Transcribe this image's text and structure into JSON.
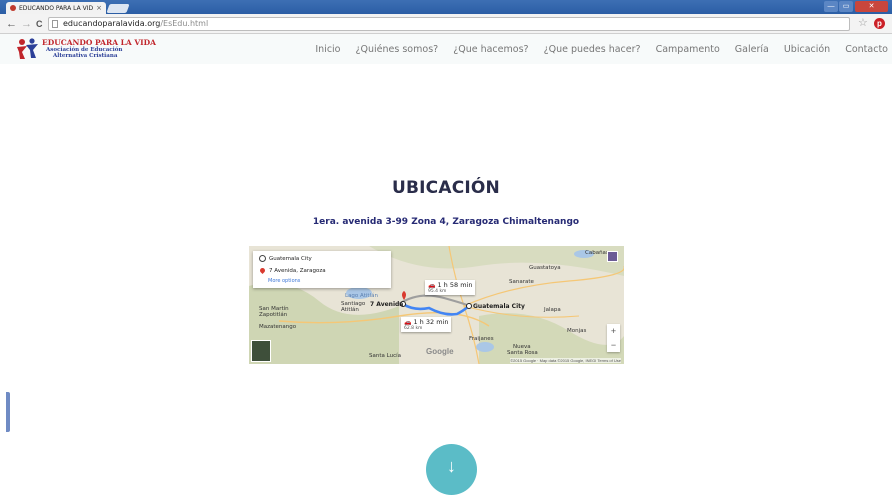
{
  "browser": {
    "tab_title": "EDUCANDO PARA LA VID",
    "tab_close": "×",
    "url_domain": "educandoparalavida.org",
    "url_path": "/EsEdu.html",
    "back": "←",
    "forward": "→",
    "reload": "C",
    "star": "☆",
    "pinterest": "p",
    "win_min": "—",
    "win_max": "▭",
    "win_close": "✕"
  },
  "site": {
    "brand_main": "EDUCANDO PARA LA VIDA",
    "brand_sub1": "Asociación de Educación",
    "brand_sub2": "Alternativa Cristiana",
    "brand_colors": {
      "red": "#c0252b",
      "blue": "#2b3f98"
    },
    "nav": [
      {
        "label": "Inicio"
      },
      {
        "label": "¿Quiénes somos?"
      },
      {
        "label": "¿Que hacemos?"
      },
      {
        "label": "¿Que puedes hacer?"
      },
      {
        "label": "Campamento"
      },
      {
        "label": "Galería"
      },
      {
        "label": "Ubicación"
      },
      {
        "label": "Contacto"
      }
    ]
  },
  "main": {
    "title": "UBICACIÓN",
    "address": "1era. avenida 3-99 Zona 4, Zaragoza Chimaltenango",
    "scroll_icon": "↓",
    "accent_color": "#5bbcc7"
  },
  "map": {
    "origin": "Guatemala City",
    "destination": "7 Avenida, Zaragoza",
    "more_options": "More options",
    "route1": {
      "time": "1 h 58 min",
      "dist": "95.4 km"
    },
    "route2": {
      "time": "1 h 32 min",
      "dist": "62.8 km"
    },
    "labels": {
      "guastatoya": "Guastatoya",
      "sanarate": "Sanarate",
      "cabanas": "Cabañas",
      "lago_atitlan": "Lago Atitlán",
      "san_martin": "San Martín",
      "zapotitlan": "Zapotitlán",
      "santiago": "Santiago",
      "atitlan": "Atitlán",
      "mazatenango": "Mazatenango",
      "jalapa": "Jalapa",
      "monjas": "Monjas",
      "fraijanes": "Fraijanes",
      "nueva_santa_rosa": "Nueva",
      "santa_rosa": "Santa Rosa",
      "santa_lucia": "Santa Lucía",
      "dest_label": "7 Avenida",
      "origin_label": "Guatemala City"
    },
    "google": "Google",
    "attribution": "©2015 Google · Map data ©2015 Google, INEGI   Terms of Use",
    "zoom_in": "+",
    "zoom_out": "−",
    "route_color": "#4285f4"
  }
}
